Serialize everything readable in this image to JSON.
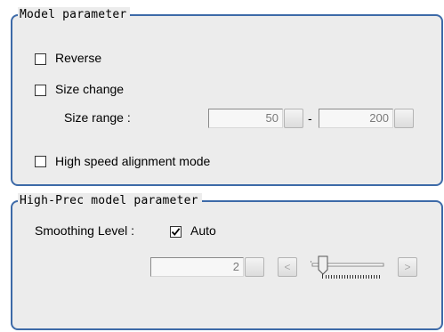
{
  "model_parameter": {
    "title": "Model parameter",
    "reverse": {
      "label": "Reverse",
      "checked": false
    },
    "size_change": {
      "label": "Size change",
      "checked": false
    },
    "size_range": {
      "label": "Size range :",
      "min": "50",
      "separator": "-",
      "max": "200"
    },
    "high_speed": {
      "label": "High speed alignment mode",
      "checked": false
    }
  },
  "high_prec_parameter": {
    "title": "High-Prec model parameter",
    "smoothing_label": "Smoothing Level :",
    "auto": {
      "label": "Auto",
      "checked": true
    },
    "level_value": "2",
    "decrement_label": "<",
    "increment_label": ">",
    "slider_position_fraction": 0.2
  },
  "colors": {
    "group_border": "#3d6aa8",
    "panel_bg": "#ececec"
  }
}
